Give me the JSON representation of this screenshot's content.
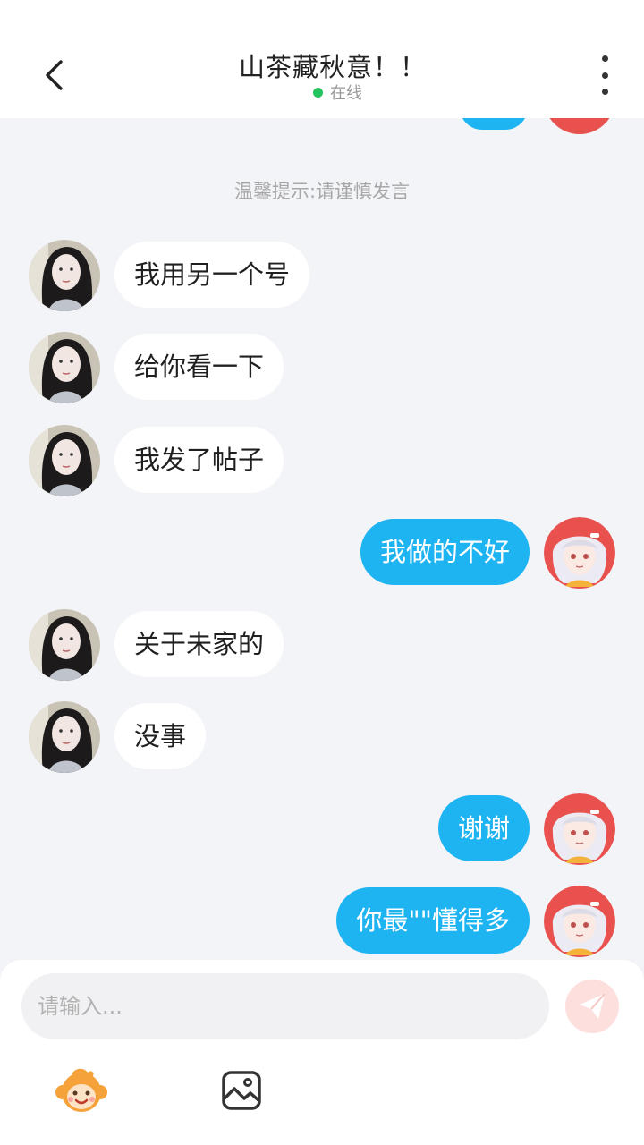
{
  "header": {
    "title": "山茶藏秋意！！",
    "presence": "在线"
  },
  "notice": "温馨提示:请谨慎发言",
  "messages": [
    {
      "from": "in",
      "text": "我用另一个号"
    },
    {
      "from": "in",
      "text": "给你看一下"
    },
    {
      "from": "in",
      "text": "我发了帖子"
    },
    {
      "from": "out",
      "text": "我做的不好"
    },
    {
      "from": "in",
      "text": "关于未家的"
    },
    {
      "from": "in",
      "text": "没事"
    },
    {
      "from": "out",
      "text": "谢谢"
    },
    {
      "from": "out",
      "text": "你最\"\"懂得多"
    }
  ],
  "composer": {
    "placeholder": "请输入..."
  },
  "icons": {
    "back": "chevron-left-icon",
    "more": "more-vertical-icon",
    "send": "send-icon",
    "emoji": "emoji-icon",
    "image": "image-icon"
  },
  "colors": {
    "accent": "#1eb4f2",
    "online": "#23c45e",
    "send_disabled": "#fde0de"
  }
}
